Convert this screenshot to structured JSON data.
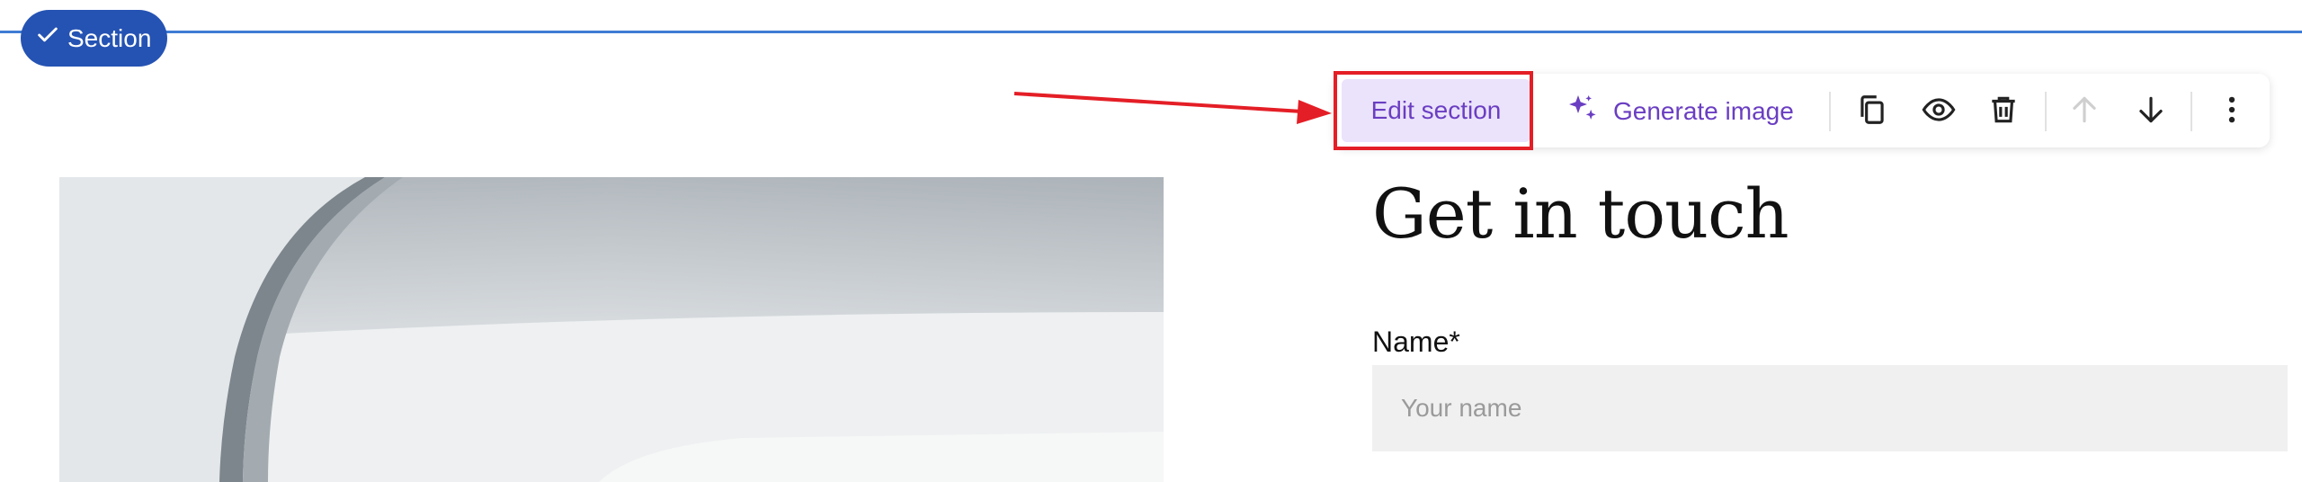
{
  "section_badge": {
    "label": "Section",
    "icon": "check-icon"
  },
  "toolbar": {
    "edit_label": "Edit section",
    "generate_label": "Generate image",
    "icons": [
      "sparkle-icon",
      "copy-icon",
      "eye-icon",
      "trash-icon",
      "arrow-up-icon",
      "arrow-down-icon",
      "more-vertical-icon"
    ]
  },
  "content": {
    "heading": "Get in touch",
    "name_label": "Name*",
    "name_placeholder": "Your name"
  },
  "colors": {
    "accent": "#6a3ec2",
    "accent_bg": "#ebe3fb",
    "section_blue": "#2553b3",
    "annotation_red": "#e41e26"
  }
}
